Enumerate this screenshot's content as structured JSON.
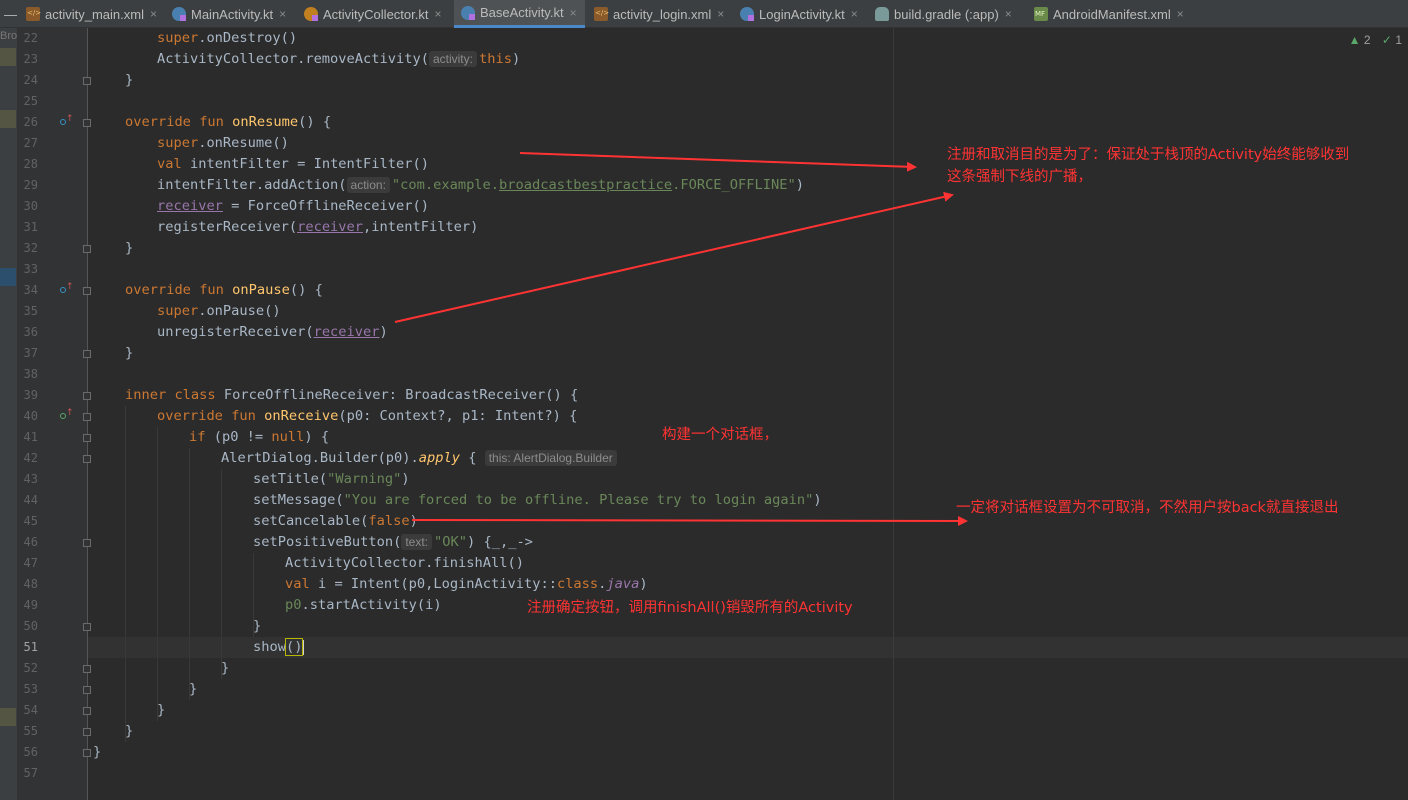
{
  "tabs": [
    {
      "label": "activity_main.xml",
      "icon": "xml-file-icon"
    },
    {
      "label": "MainActivity.kt",
      "icon": "kotlin-file-icon"
    },
    {
      "label": "ActivityCollector.kt",
      "icon": "kotlin-object-icon"
    },
    {
      "label": "BaseActivity.kt",
      "icon": "kotlin-file-icon",
      "active": true
    },
    {
      "label": "activity_login.xml",
      "icon": "xml-file-icon"
    },
    {
      "label": "LoginActivity.kt",
      "icon": "kotlin-file-icon"
    },
    {
      "label": "build.gradle (:app)",
      "icon": "gradle-icon"
    },
    {
      "label": "AndroidManifest.xml",
      "icon": "manifest-icon"
    }
  ],
  "tab_close": "×",
  "side_label": "Bro",
  "status": {
    "warnings": "2",
    "checks": "1"
  },
  "line_numbers": [
    "22",
    "23",
    "24",
    "25",
    "26",
    "27",
    "28",
    "29",
    "30",
    "31",
    "32",
    "33",
    "34",
    "35",
    "36",
    "37",
    "38",
    "39",
    "40",
    "41",
    "42",
    "43",
    "44",
    "45",
    "46",
    "47",
    "48",
    "49",
    "50",
    "51",
    "52",
    "53",
    "54",
    "55",
    "56",
    "57"
  ],
  "current_line": "51",
  "code": {
    "l22": {
      "super": "super",
      "rest": ".onDestroy()"
    },
    "l23": {
      "call": "ActivityCollector.removeActivity(",
      "hint": "activity:",
      "this": "this",
      "end": ")"
    },
    "l24": "}",
    "l26": {
      "override": "override",
      "fun": "fun",
      "name": "onResume",
      "rest": "() {"
    },
    "l27": {
      "super": "super",
      "rest": ".onResume()"
    },
    "l28": {
      "val": "val",
      "rest": " intentFilter = IntentFilter()"
    },
    "l29": {
      "call": "intentFilter.addAction(",
      "hint": "action:",
      "str1": "\"com.example.",
      "str_u": "broadcastbestpractice",
      "str2": ".FORCE_OFFLINE\"",
      "end": ")"
    },
    "l30": {
      "prop": "receiver",
      "rest": " = ForceOfflineReceiver()"
    },
    "l31": {
      "call": "registerReceiver(",
      "prop": "receiver",
      "rest": ",intentFilter)"
    },
    "l32": "}",
    "l34": {
      "override": "override",
      "fun": "fun",
      "name": "onPause",
      "rest": "() {"
    },
    "l35": {
      "super": "super",
      "rest": ".onPause()"
    },
    "l36": {
      "call": "unregisterReceiver(",
      "prop": "receiver",
      "end": ")"
    },
    "l37": "}",
    "l39": {
      "inner": "inner class",
      "rest": " ForceOfflineReceiver: BroadcastReceiver() {"
    },
    "l40": {
      "override": "override",
      "fun": "fun",
      "name": "onReceive",
      "rest": "(p0: Context?, p1: Intent?) {"
    },
    "l41": {
      "if": "if",
      "mid": " (p0 != ",
      "null": "null",
      "end": ") {"
    },
    "l42": {
      "call": "AlertDialog.Builder(p0).",
      "apply": "apply",
      "brace": " {",
      "hint": "this: AlertDialog.Builder"
    },
    "l43": {
      "call": "setTitle(",
      "str": "\"Warning\"",
      "end": ")"
    },
    "l44": {
      "call": "setMessage(",
      "str": "\"You are forced to be offline. Please try to login again\"",
      "end": ")"
    },
    "l45": {
      "call": "setCancelable(",
      "false": "false",
      "end": ")"
    },
    "l46": {
      "call": "setPositiveButton(",
      "hint": "text:",
      "str": "\"OK\"",
      "end": ") {_,_->"
    },
    "l47": "ActivityCollector.finishAll()",
    "l48": {
      "val": "val",
      "mid": " i = Intent(p0,LoginActivity::",
      "cls": "class",
      "dot": ".",
      "java": "java",
      "end": ")"
    },
    "l49": {
      "p0": "p0",
      "rest": ".startActivity(i)"
    },
    "l50": "}",
    "l51": {
      "name": "show",
      "parens": "()"
    },
    "l52": "}",
    "l53": "}",
    "l54": "}",
    "l55": "}",
    "l56": "}"
  },
  "annotations": {
    "a1_line1": "注册和取消目的是为了：保证处于栈顶的Activity始终能够收到",
    "a1_line2": "这条强制下线的广播，",
    "a2": "构建一个对话框，",
    "a3": "一定将对话框设置为不可取消，不然用户按back就直接退出",
    "a4": "注册确定按钮，调用finishAll()销毁所有的Activity"
  },
  "colors": {
    "annotation": "#ff3333",
    "background": "#2b2b2b",
    "keyword": "#cc7832",
    "string": "#6a8759",
    "function": "#ffc66d"
  }
}
